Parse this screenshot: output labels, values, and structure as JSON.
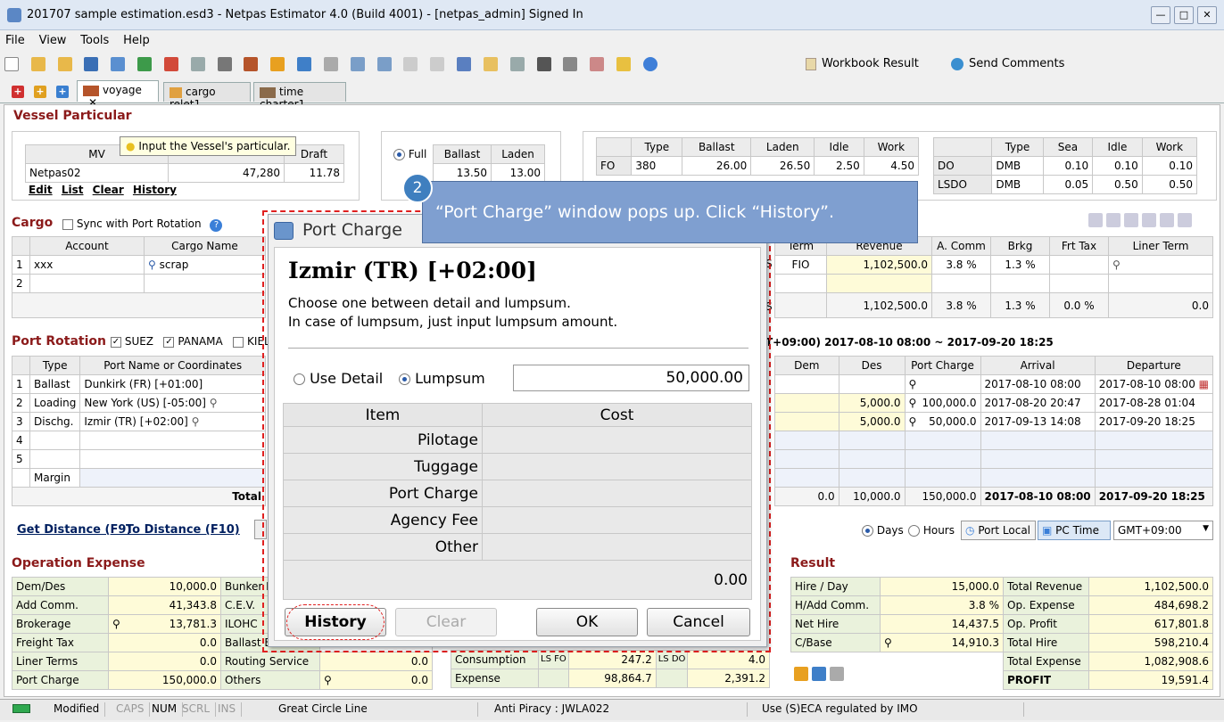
{
  "window": {
    "title": "201707 sample estimation.esd3 - Netpas Estimator 4.0 (Build 4001) - [netpas_admin] Signed In"
  },
  "menu": [
    "File",
    "View",
    "Tools",
    "Help"
  ],
  "toolbar": {
    "workbook_result": "Workbook Result",
    "send_comments": "Send Comments"
  },
  "tabs": [
    "voyage",
    "cargo relet1",
    "time charter1"
  ],
  "vessel": {
    "title": "Vessel Particular",
    "tooltip": "Input the Vessel's particular.",
    "headers": [
      "MV",
      "",
      "Draft"
    ],
    "row": [
      "Netpas02",
      "47,280",
      "11.78"
    ],
    "links": [
      "Edit",
      "List",
      "Clear",
      "History"
    ],
    "full_label": "Full",
    "ballast_hdr": "Ballast",
    "laden_hdr": "Laden",
    "speed_vals": [
      "13.50",
      "13.00"
    ]
  },
  "fuel": {
    "headers": [
      "",
      "Type",
      "Ballast",
      "Laden",
      "Idle",
      "Work"
    ],
    "rows": [
      [
        "FO",
        "380",
        "26.00",
        "26.50",
        "2.50",
        "4.50"
      ]
    ]
  },
  "fuel2": {
    "headers": [
      "",
      "Type",
      "Sea",
      "Idle",
      "Work"
    ],
    "rows": [
      [
        "DO",
        "DMB",
        "0.10",
        "0.10",
        "0.10"
      ],
      [
        "LSDO",
        "DMB",
        "0.05",
        "0.50",
        "0.50"
      ]
    ]
  },
  "cargo": {
    "title": "Cargo",
    "sync_label": "Sync with Port Rotation",
    "headers": [
      "",
      "Account",
      "Cargo Name"
    ],
    "rows": [
      [
        "1",
        "xxx",
        "scrap"
      ],
      [
        "2",
        "",
        ""
      ]
    ],
    "right_headers": [
      "Term",
      "Revenue",
      "A. Comm",
      "Brkg",
      "Frt Tax",
      "Liner Term"
    ],
    "right_row": [
      "FIO",
      "1,102,500.0",
      "3.8 %",
      "1.3 %",
      "",
      ""
    ],
    "total_row": [
      "1,102,500.0",
      "3.8 %",
      "1.3 %",
      "0.0 %",
      "0.0"
    ],
    "left_code": "S"
  },
  "port_rotation": {
    "title": "Port Rotation",
    "checks": [
      "SUEZ",
      "PANAMA",
      "KIEL"
    ],
    "period": "T+09:00) 2017-08-10 08:00 ~ 2017-09-20 18:25",
    "headers": [
      "",
      "Type",
      "Port Name or Coordinates"
    ],
    "rows": [
      [
        "1",
        "Ballast",
        "Dunkirk (FR) [+01:00]"
      ],
      [
        "2",
        "Loading",
        "New York (US) [-05:00]"
      ],
      [
        "3",
        "Dischg.",
        "Izmir (TR) [+02:00]"
      ],
      [
        "4",
        "",
        ""
      ],
      [
        "5",
        "",
        ""
      ]
    ],
    "margin_label": "Margin",
    "total_label": "Total",
    "right_headers": [
      "Dem",
      "Des",
      "Port Charge",
      "Arrival",
      "Departure"
    ],
    "right_rows": [
      [
        "",
        "",
        "",
        "2017-08-10 08:00",
        "2017-08-10 08:00"
      ],
      [
        "",
        "5,000.0",
        "100,000.0",
        "2017-08-20 20:47",
        "2017-08-28 01:04"
      ],
      [
        "",
        "5,000.0",
        "50,000.0",
        "2017-09-13 14:08",
        "2017-09-20 18:25"
      ]
    ],
    "right_total": [
      "0.0",
      "10,000.0",
      "150,000.0",
      "2017-08-10 08:00",
      "2017-09-20 18:25"
    ]
  },
  "links": {
    "get_distance": "Get Distance (F9)",
    "to_distance": "To Distance (F10)"
  },
  "time_opts": {
    "days": "Days",
    "hours": "Hours",
    "port_local": "Port Local",
    "pc_time": "PC Time",
    "gmt": "GMT+09:00"
  },
  "opex": {
    "title": "Operation Expense",
    "rows": [
      [
        "Dem/Des",
        "10,000.0",
        "Bunker B"
      ],
      [
        "Add Comm.",
        "41,343.8",
        "C.E.V."
      ],
      [
        "Brokerage",
        "13,781.3",
        "ILOHC"
      ],
      [
        "Freight Tax",
        "0.0",
        "Ballast B"
      ],
      [
        "Liner Terms",
        "0.0",
        "Routing Service"
      ],
      [
        "Port Charge",
        "150,000.0",
        "Others"
      ]
    ],
    "routing_val": "0.0",
    "others_val": "0.0",
    "consumption_label": "Consumption",
    "expense_label": "Expense",
    "ls_fo": "LS FO",
    "ls_do": "LS DO",
    "cons_vals": [
      "247.2",
      "4.0"
    ],
    "exp_vals": [
      "98,864.7",
      "2,391.2"
    ]
  },
  "result": {
    "title": "Result",
    "left": [
      [
        "Hire / Day",
        "15,000.0"
      ],
      [
        "H/Add Comm.",
        "3.8 %"
      ],
      [
        "Net Hire",
        "14,437.5"
      ],
      [
        "C/Base",
        "14,910.3"
      ]
    ],
    "right": [
      [
        "Total Revenue",
        "1,102,500.0"
      ],
      [
        "Op. Expense",
        "484,698.2"
      ],
      [
        "Op. Profit",
        "617,801.8"
      ],
      [
        "Total Hire",
        "598,210.4"
      ],
      [
        "Total Expense",
        "1,082,908.6"
      ],
      [
        "PROFIT",
        "19,591.4"
      ]
    ]
  },
  "dialog": {
    "title": "Port Charge",
    "port": "Izmir (TR) [+02:00]",
    "desc1": "Choose one between detail and lumpsum.",
    "desc2": "In case of lumpsum, just input lumpsum amount.",
    "use_detail": "Use Detail",
    "lumpsum": "Lumpsum",
    "lumpsum_value": "50,000.00",
    "headers": [
      "Item",
      "Cost"
    ],
    "items": [
      "Pilotage",
      "Tuggage",
      "Port Charge",
      "Agency Fee",
      "Other"
    ],
    "total": "0.00",
    "buttons": {
      "history": "History",
      "clear": "Clear",
      "ok": "OK",
      "cancel": "Cancel"
    }
  },
  "callout": {
    "step": "2",
    "text": "“Port Charge” window pops up. Click “History”."
  },
  "status": [
    "Modified",
    "CAPS",
    "NUM",
    "SCRL",
    "INS",
    "Great Circle Line",
    "Anti Piracy : JWLA022",
    "Use (S)ECA regulated by IMO"
  ],
  "colors": {
    "section": "#8b1a1a",
    "callout": "#7f9fd0",
    "highlight": "#e02020"
  }
}
